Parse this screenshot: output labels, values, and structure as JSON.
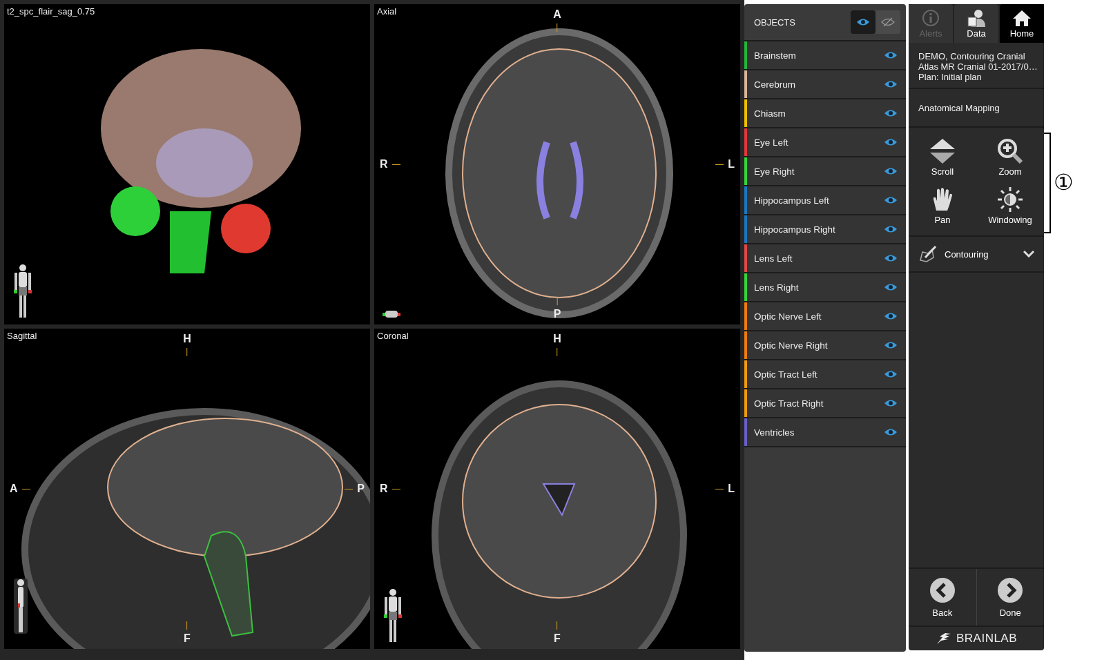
{
  "viewports": [
    {
      "kind": "render",
      "label": "t2_spc_flair_sag_0.75"
    },
    {
      "kind": "axial",
      "label": "Axial",
      "markers": {
        "top": "A",
        "left": "R",
        "right": "L",
        "bottom": "P"
      }
    },
    {
      "kind": "sagittal",
      "label": "Sagittal",
      "markers": {
        "top": "H",
        "left": "A",
        "right": "P",
        "bottom": "F"
      }
    },
    {
      "kind": "coronal",
      "label": "Coronal",
      "markers": {
        "top": "H",
        "left": "R",
        "right": "L",
        "bottom": "F"
      }
    }
  ],
  "objects": {
    "title": "OBJECTS",
    "toggle": [
      {
        "kind": "show",
        "selected": true
      },
      {
        "kind": "hide",
        "selected": false
      }
    ],
    "items": [
      {
        "name": "Brainstem",
        "color": "#22b83a",
        "visible": true
      },
      {
        "name": "Cerebrum",
        "color": "#d9b49a",
        "visible": true
      },
      {
        "name": "Chiasm",
        "color": "#f0c000",
        "visible": true
      },
      {
        "name": "Eye Left",
        "color": "#e0393a",
        "visible": true
      },
      {
        "name": "Eye Right",
        "color": "#33d63a",
        "visible": true
      },
      {
        "name": "Hippocampus Left",
        "color": "#1a78c2",
        "visible": true
      },
      {
        "name": "Hippocampus Right",
        "color": "#1a78c2",
        "visible": true
      },
      {
        "name": "Lens Left",
        "color": "#e04848",
        "visible": true
      },
      {
        "name": "Lens Right",
        "color": "#33d63a",
        "visible": true
      },
      {
        "name": "Optic Nerve Left",
        "color": "#f07c10",
        "visible": true
      },
      {
        "name": "Optic Nerve Right",
        "color": "#f07c10",
        "visible": true
      },
      {
        "name": "Optic Tract Left",
        "color": "#f09a10",
        "visible": true
      },
      {
        "name": "Optic Tract Right",
        "color": "#f09a10",
        "visible": true
      },
      {
        "name": "Ventricles",
        "color": "#6a60c8",
        "visible": true
      }
    ]
  },
  "nav_tabs": [
    {
      "kind": "alerts",
      "label": "Alerts",
      "selected": false,
      "disabled": true
    },
    {
      "kind": "data",
      "label": "Data",
      "selected": false,
      "disabled": false
    },
    {
      "kind": "home",
      "label": "Home",
      "selected": true,
      "disabled": false
    }
  ],
  "patient_info": [
    "DEMO, Contouring Cranial",
    "Atlas MR Cranial 01-2017/0…",
    "Plan: Initial plan"
  ],
  "step": "Anatomical Mapping",
  "tools": [
    {
      "kind": "scroll",
      "label": "Scroll"
    },
    {
      "kind": "zoom",
      "label": "Zoom"
    },
    {
      "kind": "pan",
      "label": "Pan"
    },
    {
      "kind": "windowing",
      "label": "Windowing"
    }
  ],
  "contouring": {
    "label": "Contouring",
    "expanded": false
  },
  "footer_buttons": [
    {
      "kind": "back",
      "label": "Back"
    },
    {
      "kind": "done",
      "label": "Done"
    }
  ],
  "brand": "BRAINLAB",
  "callout": "①"
}
